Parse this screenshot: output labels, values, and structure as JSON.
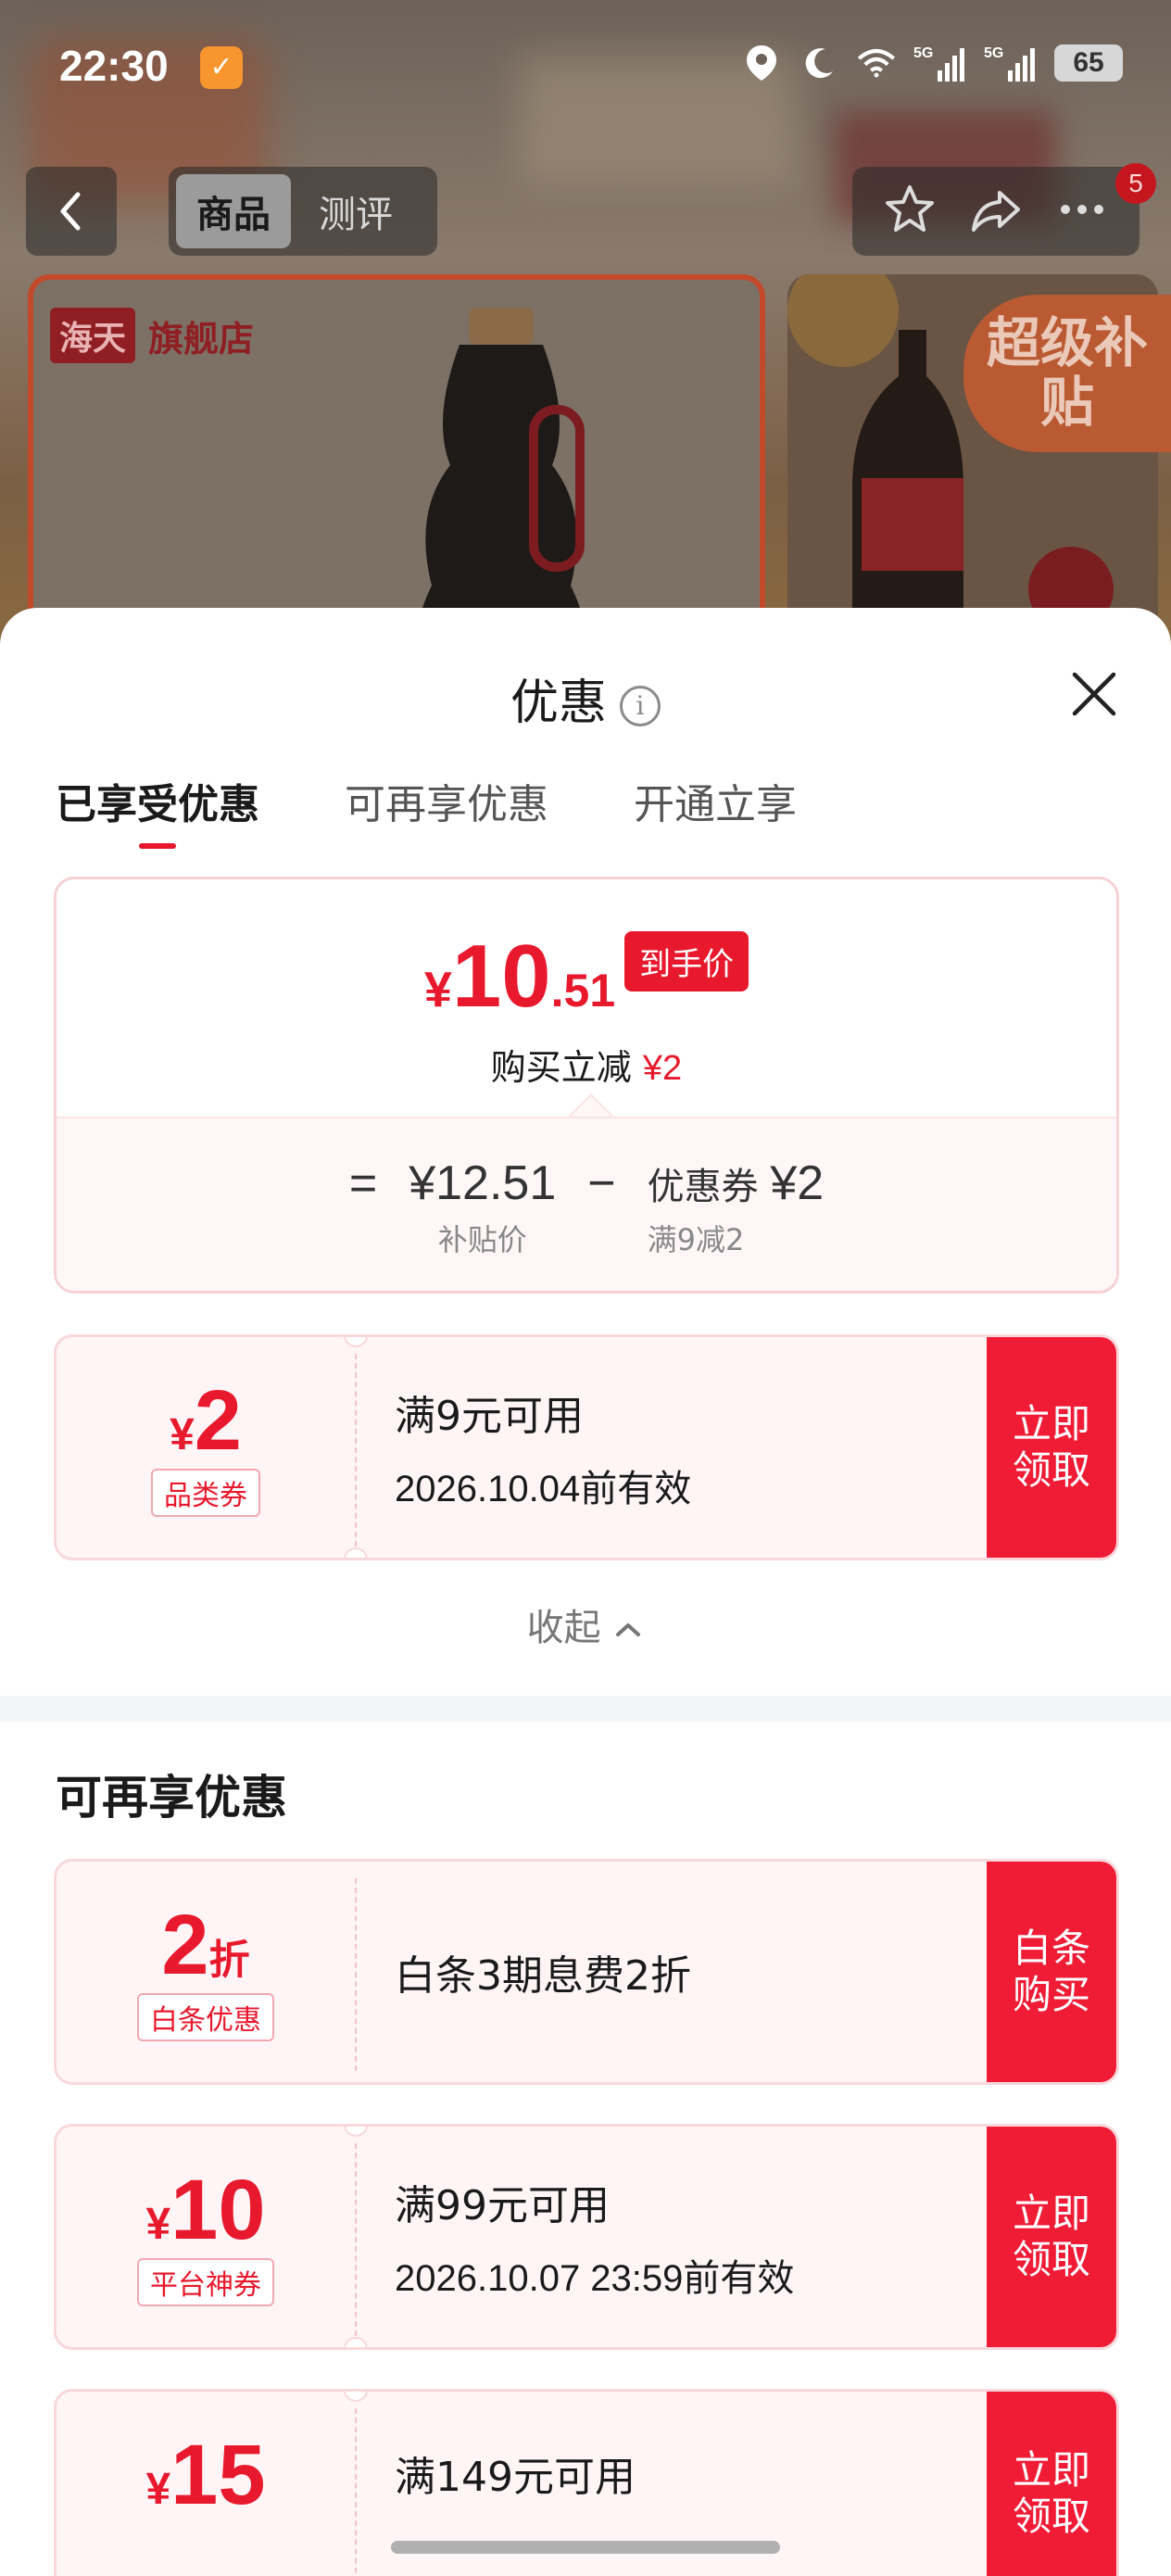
{
  "status_bar": {
    "time": "22:30",
    "battery": "65",
    "network_1": "5G",
    "network_2": "5G"
  },
  "nav": {
    "tabs": [
      {
        "label": "商品"
      },
      {
        "label": "测评"
      }
    ],
    "cart_count": "5"
  },
  "product_preview": {
    "brand": "海天",
    "store": "旗舰店",
    "side_badge": "超级补贴"
  },
  "sheet": {
    "title": "优惠",
    "info_icon": "i",
    "tabs": [
      {
        "label": "已享受优惠"
      },
      {
        "label": "可再享优惠"
      },
      {
        "label": "开通立享"
      }
    ],
    "price_card": {
      "currency": "¥",
      "price_int": "10",
      "price_dec": ".51",
      "final_tag": "到手价",
      "instant_cut_label": "购买立减",
      "instant_cut_value": "¥2",
      "equals": "=",
      "base_price": "¥12.51",
      "base_price_label": "补贴价",
      "minus": "−",
      "coupon_label": "优惠券",
      "coupon_amount": "¥2",
      "coupon_rule": "满9减2"
    },
    "applied_coupons": [
      {
        "currency": "¥",
        "value": "2",
        "tag": "品类券",
        "condition": "满9元可用",
        "validity": "2026.10.04前有效",
        "action": "立即领取"
      }
    ],
    "collapse_label": "收起",
    "more_section_title": "可再享优惠",
    "more_offers": [
      {
        "currency": "",
        "value": "2",
        "suffix": "折",
        "tag": "白条优惠",
        "condition": "白条3期息费2折",
        "validity": "",
        "action": "白条购买"
      },
      {
        "currency": "¥",
        "value": "10",
        "suffix": "",
        "tag": "平台神券",
        "condition": "满99元可用",
        "validity": "2026.10.07 23:59前有效",
        "action": "立即领取"
      },
      {
        "currency": "¥",
        "value": "15",
        "suffix": "",
        "tag": "",
        "condition": "满149元可用",
        "validity": "",
        "action": "立即领取"
      }
    ]
  },
  "colors": {
    "accent_red": "#e8192c",
    "button_red": "#f01b35",
    "coupon_bg": "#fff5f6"
  }
}
